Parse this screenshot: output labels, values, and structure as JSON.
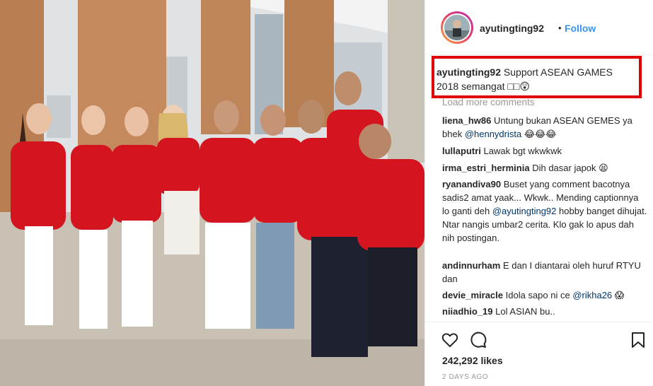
{
  "post": {
    "username": "ayutingting92",
    "separator": "•",
    "follow_label": "Follow",
    "caption_text": "Support ASEAN GAMES 2018 semangat □□😲",
    "load_more": "Load more comments",
    "likes": "242,292 likes",
    "time": "2 DAYS AGO"
  },
  "comments": [
    {
      "user": "liena_hw86",
      "text": "Untung bukan ASEAN GEMES ya bhek ",
      "mention": "@hennydrista",
      "tail": " 😂😂😂"
    },
    {
      "user": "lullaputri",
      "text": "Lawak bgt wkwkwk",
      "mention": "",
      "tail": ""
    },
    {
      "user": "irma_estri_herminia",
      "text": "Dih dasar japok 😫",
      "mention": "",
      "tail": ""
    },
    {
      "user": "ryanandiva90",
      "text": "Buset yang comment bacotnya sadis2 amat yaak... Wkwk.. Mending captionnya lo ganti deh ",
      "mention": "@ayutingting92",
      "tail": " hobby banget dihujat. Ntar nangis umbar2 cerita. Klo gak lo apus dah nih postingan."
    },
    {
      "user": "andinnurham",
      "text": "E dan I diantarai oleh huruf RTYU dan",
      "mention": "",
      "tail": ""
    },
    {
      "user": "devie_miracle",
      "text": "Idola sapo ni ce ",
      "mention": "@rikha26",
      "tail": " 😱"
    },
    {
      "user": "niiadhio_19",
      "text": "Lol ASIAN bu..",
      "mention": "",
      "tail": ""
    }
  ],
  "icons": {
    "like": "heart-icon",
    "comment": "comment-icon",
    "save": "bookmark-icon"
  },
  "colors": {
    "accent": "#3897f0",
    "highlight_box": "#e00000",
    "shirt_red": "#d4141e"
  }
}
